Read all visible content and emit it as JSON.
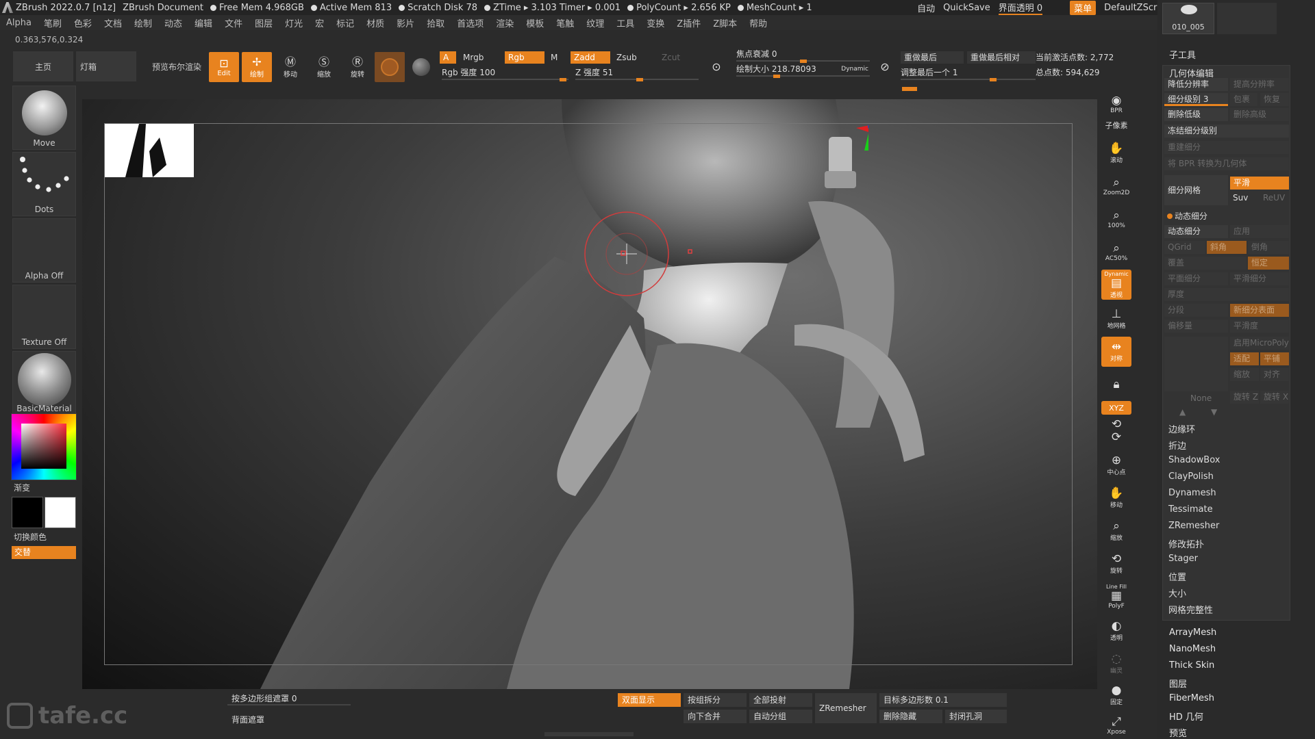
{
  "titlebar": {
    "app": "ZBrush 2022.0.7 [n1z]",
    "doc": "ZBrush Document",
    "free_mem": "Free Mem 4.968GB",
    "active_mem": "Active Mem 813",
    "scratch": "Scratch Disk 78",
    "ztime": "ZTime ▸ 3.103 Timer ▸ 0.001",
    "polycount": "PolyCount ▸ 2.656 KP",
    "meshcount": "MeshCount ▸ 1",
    "auto": "自动",
    "quicksave": "QuickSave",
    "transparency": "界面透明 0",
    "menu": "菜单",
    "script": "DefaultZScript"
  },
  "menu": [
    "Alpha",
    "笔刷",
    "色彩",
    "文档",
    "绘制",
    "动态",
    "编辑",
    "文件",
    "图层",
    "灯光",
    "宏",
    "标记",
    "材质",
    "影片",
    "拾取",
    "首选项",
    "渲染",
    "模板",
    "笔触",
    "纹理",
    "工具",
    "变换",
    "Z插件",
    "Z脚本",
    "帮助"
  ],
  "coords": "0.363,576,0.324",
  "leftshelf": {
    "move": "Move",
    "dots": "Dots",
    "alpha": "Alpha Off",
    "texture": "Texture Off",
    "material": "BasicMaterial",
    "gradient": "渐变",
    "switch_color": "切换颜色",
    "alternate": "交替"
  },
  "topshelf": {
    "home": "主页",
    "lightbox": "灯箱",
    "preview": "预览布尔渲染",
    "edit": "Edit",
    "draw": "绘制",
    "move": "移动",
    "scale": "缩放",
    "rotate": "旋转",
    "a": "A",
    "mrgb": "Mrgb",
    "rgb": "Rgb",
    "m": "M",
    "rgb_intensity": "Rgb 强度 100",
    "zadd": "Zadd",
    "zsub": "Zsub",
    "zcut": "Zcut",
    "z_intensity": "Z 强度 51",
    "focal": "焦点衰减 0",
    "draw_size": "绘制大小 218.78093",
    "dynamic": "Dynamic",
    "replay_last": "重做最后",
    "replay_last_rel": "重做最后相对",
    "adjust_last": "调整最后一个 1",
    "active_points": "当前激活点数: 2,772",
    "total_points": "总点数: 594,629"
  },
  "rightcol": [
    "BPR",
    "子像素",
    "滚动",
    "Zoom2D",
    "100%",
    "AC50%",
    "透视",
    "地网格",
    "对称",
    "锁定",
    "XYZ",
    "中心点",
    "移动",
    "缩放",
    "旋转",
    "PolyF",
    "透明",
    "幽灵",
    "固定",
    "Xpose"
  ],
  "rightcol_labels": {
    "dynamic": "Dynamic",
    "line_fill": "Line Fill"
  },
  "rtray": {
    "thumb_name": "010_005",
    "subtool": "子工具",
    "geometry": "几何体编辑",
    "lower_res": "降低分辨率",
    "higher_res": "提高分辨率",
    "sdiv": "细分级别 3",
    "cage": "包裹",
    "rstr": "恢复",
    "del_lower": "删除低级",
    "del_higher": "删除高级",
    "freeze": "冻结细分级别",
    "reconstruct": "重建细分",
    "bpr_to_geo": "将 BPR 转换为几何体",
    "divide": "细分网格",
    "smooth": "平滑",
    "suv": "Suv",
    "reuv": "ReUV",
    "dyn_sub_header": "动态细分",
    "dyn_sub": "动态细分",
    "apply": "应用",
    "qgrid": "QGrid",
    "bevel": "斜角",
    "chamfer": "倒角",
    "coverage": "覆盖",
    "constant": "恒定",
    "flat_sub": "平面细分",
    "smooth_sub": "平滑细分",
    "thickness": "厚度",
    "segments": "分段",
    "new_sub_surface": "新细分表面",
    "offset": "偏移量",
    "smooth_level": "平滑度",
    "micropoly": "启用MicroPoly",
    "none": "None",
    "fit": "适配",
    "tile": "平铺",
    "scale": "缩放",
    "align": "对齐",
    "rot_z": "旋转 Z",
    "rot_x": "旋转 X",
    "items": [
      "边缘环",
      "折边",
      "ShadowBox",
      "ClayPolish",
      "Dynamesh",
      "Tessimate",
      "ZRemesher",
      "修改拓扑",
      "Stager",
      "位置",
      "大小",
      "网格完整性"
    ],
    "below": [
      "ArrayMesh",
      "NanoMesh",
      "Thick Skin",
      "图层",
      "FiberMesh",
      "HD 几何",
      "预览"
    ]
  },
  "bottom": {
    "polygroup_mask": "按多边形组遮罩 0",
    "backface": "背面遮罩",
    "double": "双面显示",
    "group_split": "按组拆分",
    "project_all": "全部投射",
    "merge_down": "向下合并",
    "auto_group": "自动分组",
    "zremesher": "ZRemesher",
    "target_poly": "目标多边形数 0.1",
    "del_hidden": "删除隐藏",
    "close_holes": "封闭孔洞"
  },
  "watermark": "tafe.cc",
  "colors": {
    "accent": "#e8831f",
    "bg": "#2b2b2b",
    "panel": "#333333"
  }
}
